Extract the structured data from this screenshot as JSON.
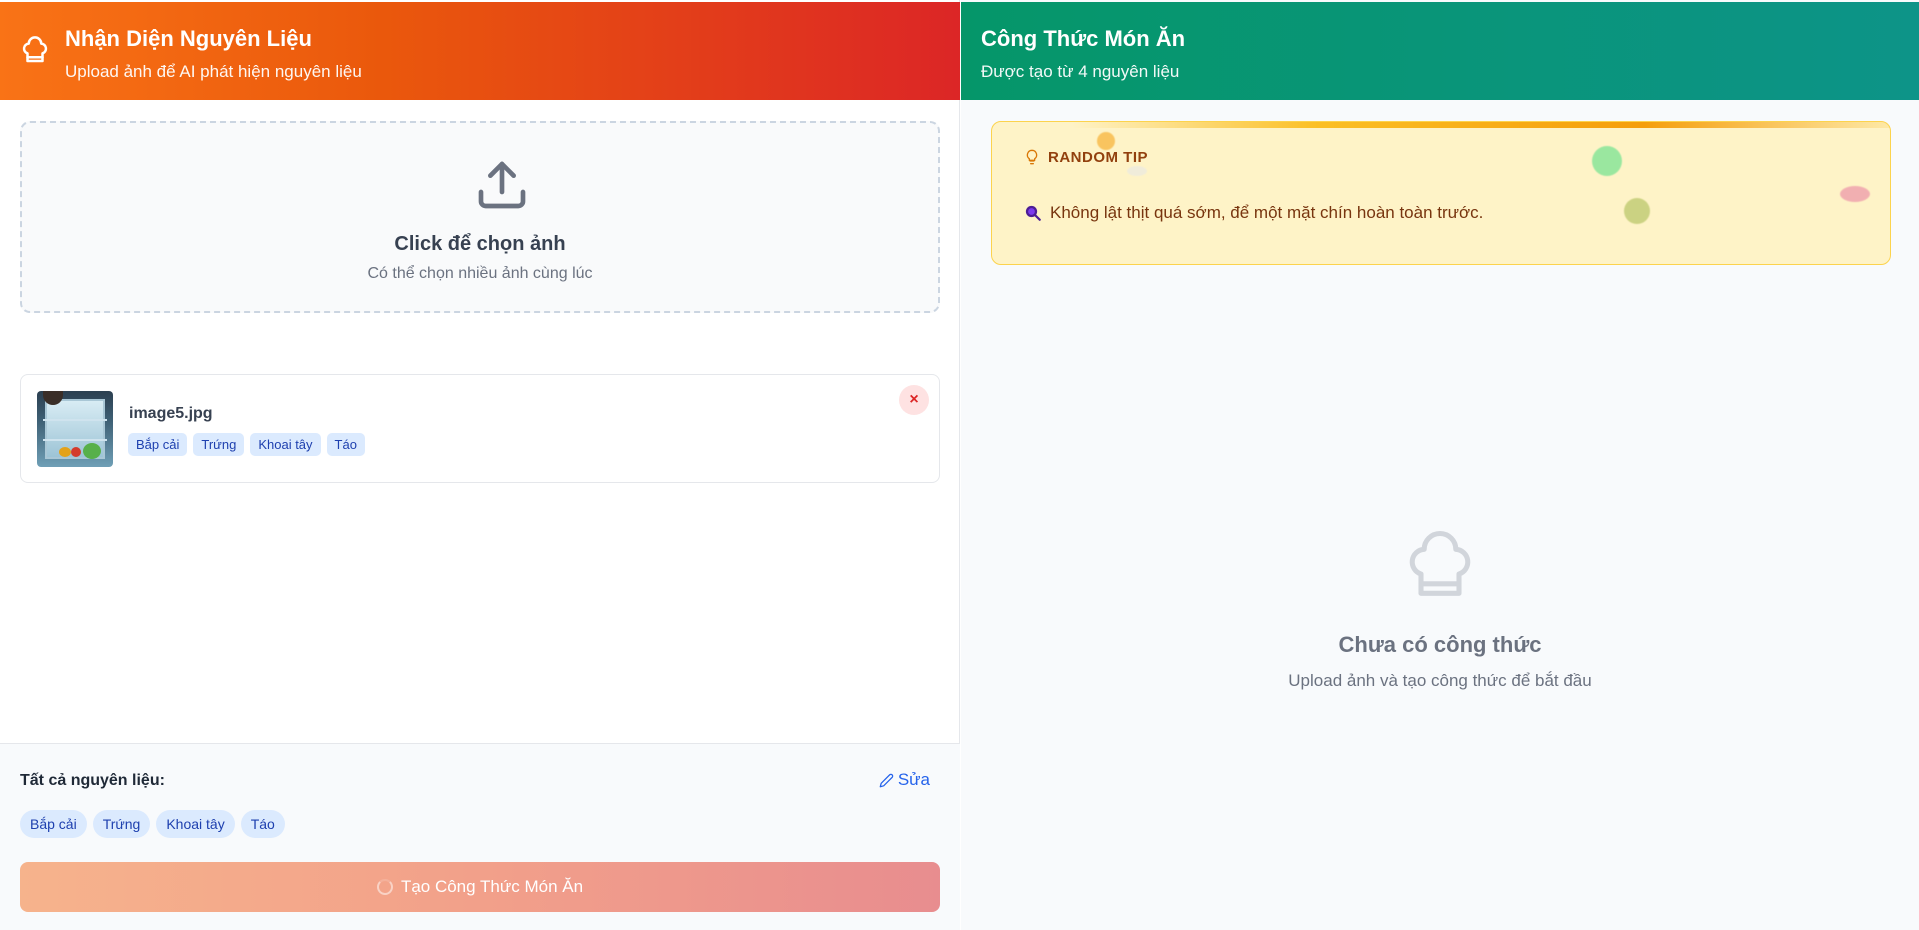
{
  "left_panel": {
    "header": {
      "title": "Nhận Diện Nguyên Liệu",
      "subtitle": "Upload ảnh để AI phát hiện nguyên liệu",
      "icon": "chef-hat-icon"
    },
    "dropzone": {
      "title": "Click để chọn ảnh",
      "subtitle": "Có thể chọn nhiều ảnh cùng lúc",
      "icon": "upload-icon"
    },
    "uploaded_images": [
      {
        "file_name": "image5.jpg",
        "tags": [
          "Bắp cải",
          "Trứng",
          "Khoai tây",
          "Táo"
        ],
        "remove_label": "×"
      }
    ],
    "all_ingredients": {
      "label": "Tất cả nguyên liệu:",
      "edit_label": "Sửa",
      "tags": [
        "Bắp cải",
        "Trứng",
        "Khoai tây",
        "Táo"
      ]
    },
    "create_button": {
      "label": "Tạo Công Thức Món Ăn",
      "state": "loading"
    }
  },
  "right_panel": {
    "header": {
      "title": "Công Thức Món Ăn",
      "subtitle": "Được tạo từ 4 nguyên liệu"
    },
    "tip": {
      "label": "RANDOM TIP",
      "text": "Không lật thịt quá sớm, để một mặt chín hoàn toàn trước.",
      "icon": "lightbulb-icon",
      "text_icon": "magnifier-icon"
    },
    "empty_state": {
      "title": "Chưa có công thức",
      "subtitle": "Upload ảnh và tạo công thức để bắt đầu",
      "icon": "chef-hat-icon"
    }
  },
  "colors": {
    "left_header_start": "#f97316",
    "left_header_end": "#dc2626",
    "right_header_start": "#059669",
    "right_header_end": "#0d9488",
    "tag_bg": "#dbeafe",
    "tag_text": "#1e40af",
    "link": "#2563eb",
    "tip_bg": "#fef3c7"
  }
}
